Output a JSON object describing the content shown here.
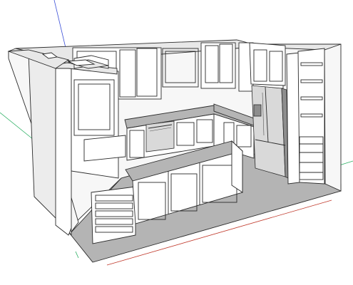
{
  "canvas": {
    "background": "#ffffff",
    "line_color": "#2b2b2b",
    "floor_color": "#b4b4b4",
    "axis_colors": {
      "red": "#c0392b",
      "green": "#27ae60",
      "blue": "#3b4fd8"
    }
  },
  "model": {
    "room": "kitchen",
    "objects": [
      "walls",
      "floor",
      "upper-cabinets",
      "base-cabinets",
      "countertop",
      "island",
      "refrigerator",
      "dishwasher",
      "open-shelving",
      "pantry-drawers",
      "range-hood-cabinet"
    ]
  }
}
